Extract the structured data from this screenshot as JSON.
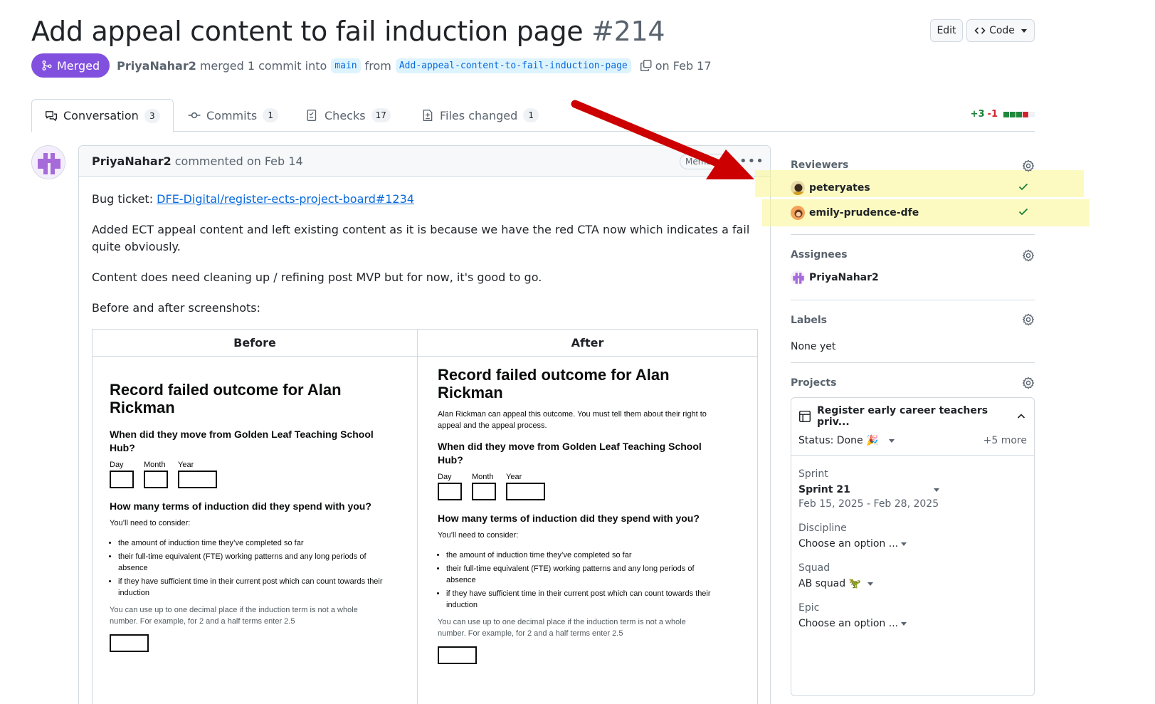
{
  "pr": {
    "title": "Add appeal content to fail induction page",
    "number": "#214",
    "state_label": "Merged",
    "author": "PriyaNahar2",
    "merge_text": "merged 1 commit into",
    "base_branch": "main",
    "from_text": "from",
    "head_branch": "Add-appeal-content-to-fail-induction-page",
    "date_text": "on Feb 17"
  },
  "header_buttons": {
    "edit": "Edit",
    "code": "Code"
  },
  "tabs": [
    {
      "label": "Conversation",
      "count": "3",
      "icon": "conversation-icon"
    },
    {
      "label": "Commits",
      "count": "1",
      "icon": "commit-icon"
    },
    {
      "label": "Checks",
      "count": "17",
      "icon": "checks-icon"
    },
    {
      "label": "Files changed",
      "count": "1",
      "icon": "file-diff-icon"
    }
  ],
  "diffstat": {
    "additions": "+3",
    "deletions": "-1"
  },
  "comment": {
    "author": "PriyaNahar2",
    "action": "commented on Feb 14",
    "badge": "Member",
    "bug_ticket_label": "Bug ticket:",
    "bug_ticket_link": "DFE-Digital/register-ects-project-board#1234",
    "para1": "Added ECT appeal content and left existing content as it is because we have the red CTA now which indicates a fail quite obviously.",
    "para2": "Content does need cleaning up / refining post MVP but for now, it's good to go.",
    "para3": "Before and after screenshots:",
    "table": {
      "col_before": "Before",
      "col_after": "After"
    }
  },
  "screenshot": {
    "heading": "Record failed outcome for Alan Rickman",
    "appeal_text": "Alan Rickman can appeal this outcome. You must tell them about their right to appeal and the appeal process.",
    "q1": "When did they move from Golden Leaf Teaching School Hub?",
    "day": "Day",
    "month": "Month",
    "year": "Year",
    "q2": "How many terms of induction did they spend with you?",
    "consider": "You’ll need to consider:",
    "bullets": [
      "the amount of induction time they’ve completed so far",
      "their full-time equivalent (FTE) working patterns and any long periods of absence",
      "if they have sufficient time in their current post which can count towards their induction"
    ],
    "hint": "You can use up to one decimal place if the induction term is not a whole number. For example, for 2 and a half terms enter 2.5"
  },
  "sidebar": {
    "reviewers_title": "Reviewers",
    "reviewers": [
      {
        "name": "peteryates",
        "status": "approved"
      },
      {
        "name": "emily-prudence-dfe",
        "status": "approved"
      }
    ],
    "assignees_title": "Assignees",
    "assignee": "PriyaNahar2",
    "labels_title": "Labels",
    "labels_value": "None yet",
    "projects_title": "Projects",
    "project": {
      "name": "Register early career teachers priv...",
      "status": "Status: Done 🎉",
      "more": "+5 more",
      "sprint_label": "Sprint",
      "sprint_value": "Sprint 21",
      "sprint_dates": "Feb 15, 2025 - Feb 28, 2025",
      "discipline_label": "Discipline",
      "discipline_value": "Choose an option ...",
      "squad_label": "Squad",
      "squad_value": "AB squad 🦖",
      "epic_label": "Epic",
      "epic_value": "Choose an option ..."
    }
  },
  "colors": {
    "merged": "#8250df",
    "link": "#0969da",
    "success": "#1a7f37",
    "danger": "#d1242f",
    "annotation_arrow": "#cc0000",
    "highlight": "#faf68c"
  }
}
